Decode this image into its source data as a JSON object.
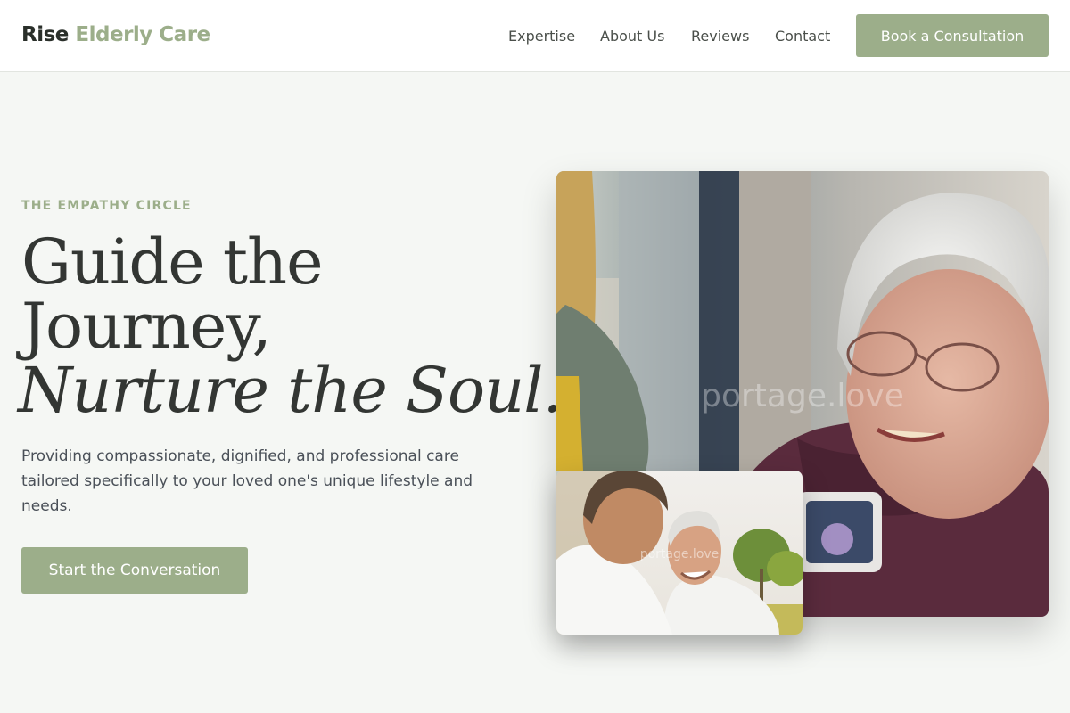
{
  "header": {
    "logo_part1": "Rise",
    "logo_part2": "Elderly Care",
    "nav": [
      "Expertise",
      "About Us",
      "Reviews",
      "Contact"
    ],
    "cta_label": "Book a Consultation"
  },
  "hero": {
    "eyebrow": "THE EMPATHY CIRCLE",
    "headline_line1": "Guide the",
    "headline_line2": "Journey,",
    "headline_italic": "Nurture the Soul.",
    "subtitle": "Providing compassionate, dignified, and professional care tailored specifically to your loved one's unique lifestyle and needs.",
    "cta_label": "Start the Conversation"
  },
  "images": {
    "main_watermark": "portage.love",
    "small_watermark": "portage.love"
  },
  "colors": {
    "accent": "#9cae8a",
    "text_dark": "#333633",
    "background": "#f5f7f4"
  }
}
